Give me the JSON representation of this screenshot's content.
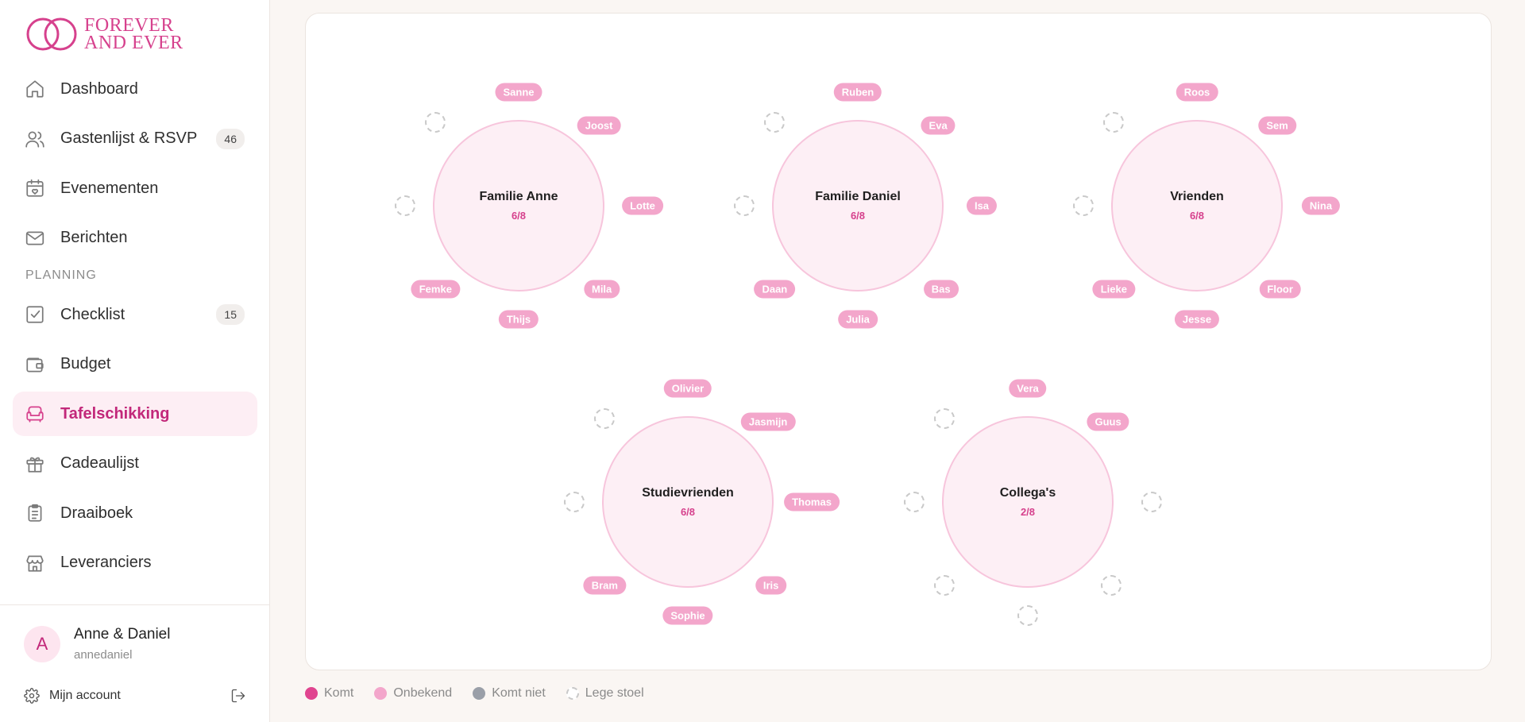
{
  "brand": {
    "line1": "FOREVER",
    "line2": "AND EVER",
    "accent": "#d6418d"
  },
  "nav": {
    "items": [
      {
        "label": "Dashboard",
        "icon": "home-icon"
      },
      {
        "label": "Gastenlijst & RSVP",
        "icon": "users-icon",
        "badge": "46"
      },
      {
        "label": "Evenementen",
        "icon": "calendar-heart-icon"
      },
      {
        "label": "Berichten",
        "icon": "mail-icon"
      }
    ],
    "section_label": "PLANNING",
    "planning": [
      {
        "label": "Checklist",
        "icon": "checkbox-icon",
        "badge": "15"
      },
      {
        "label": "Budget",
        "icon": "wallet-icon"
      },
      {
        "label": "Tafelschikking",
        "icon": "sofa-icon",
        "active": true
      },
      {
        "label": "Cadeaulijst",
        "icon": "gift-icon"
      },
      {
        "label": "Draaiboek",
        "icon": "clipboard-icon"
      },
      {
        "label": "Leveranciers",
        "icon": "store-icon"
      }
    ]
  },
  "user": {
    "initial": "A",
    "name": "Anne & Daniel",
    "handle": "annedaniel",
    "account_label": "Mijn account"
  },
  "tables": [
    {
      "name": "Familie Anne",
      "count": "6/8",
      "guests": [
        "Sanne",
        "Joost",
        "Lotte",
        "Mila",
        "Thijs",
        "Femke"
      ]
    },
    {
      "name": "Familie Daniel",
      "count": "6/8",
      "guests": [
        "Ruben",
        "Eva",
        "Isa",
        "Bas",
        "Julia",
        "Daan"
      ]
    },
    {
      "name": "Vrienden",
      "count": "6/8",
      "guests": [
        "Roos",
        "Sem",
        "Nina",
        "Floor",
        "Jesse",
        "Lieke"
      ]
    },
    {
      "name": "Studievrienden",
      "count": "6/8",
      "guests": [
        "Olivier",
        "Jasmijn",
        "Thomas",
        "Iris",
        "Sophie",
        "Bram"
      ]
    },
    {
      "name": "Collega's",
      "count": "2/8",
      "guests": [
        "Vera",
        "Guus"
      ]
    }
  ],
  "legend": [
    {
      "label": "Komt",
      "color": "#e0448f"
    },
    {
      "label": "Onbekend",
      "color": "#f3a6cb"
    },
    {
      "label": "Komt niet",
      "color": "#9a9fa8"
    },
    {
      "label": "Lege stoel",
      "color": "#c9c9c9"
    }
  ]
}
